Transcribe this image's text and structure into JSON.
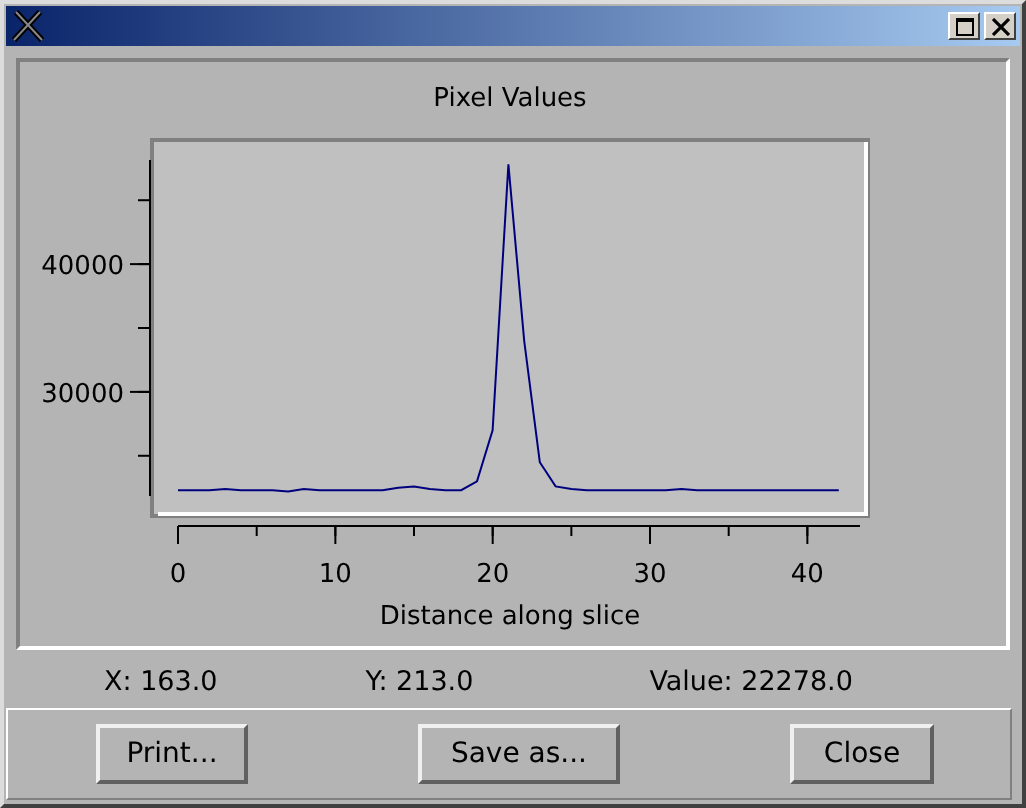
{
  "chart": {
    "chart_data": {
      "type": "line",
      "title": "Pixel Values",
      "xlabel": "Distance along slice",
      "x": [
        0,
        1,
        2,
        3,
        4,
        5,
        6,
        7,
        8,
        9,
        10,
        11,
        12,
        13,
        14,
        15,
        16,
        17,
        18,
        19,
        20,
        21,
        22,
        23,
        24,
        25,
        26,
        27,
        28,
        29,
        30,
        31,
        32,
        33,
        34,
        35,
        36,
        37,
        38,
        39,
        40,
        41,
        42
      ],
      "series": [
        {
          "color": "#00007f",
          "values": [
            22300,
            22300,
            22300,
            22400,
            22300,
            22300,
            22300,
            22200,
            22400,
            22300,
            22300,
            22300,
            22300,
            22300,
            22500,
            22600,
            22400,
            22300,
            22300,
            23000,
            27000,
            47800,
            34000,
            24500,
            22600,
            22400,
            22300,
            22300,
            22300,
            22300,
            22300,
            22300,
            22400,
            22300,
            22300,
            22300,
            22300,
            22300,
            22300,
            22300,
            22300,
            22300,
            22300
          ]
        }
      ],
      "xlim": [
        -1.4,
        43.6
      ],
      "ylim": [
        20600,
        49400
      ],
      "xticks": [
        0,
        10,
        20,
        30,
        40
      ],
      "yticks": [
        30000,
        40000
      ]
    }
  },
  "status": [
    {
      "label": "X:",
      "value": "163.0"
    },
    {
      "label": "Y:",
      "value": "213.0"
    },
    {
      "label": "Value:",
      "value": "22278.0"
    }
  ],
  "buttons": [
    "Print...",
    "Save as...",
    "Close"
  ]
}
